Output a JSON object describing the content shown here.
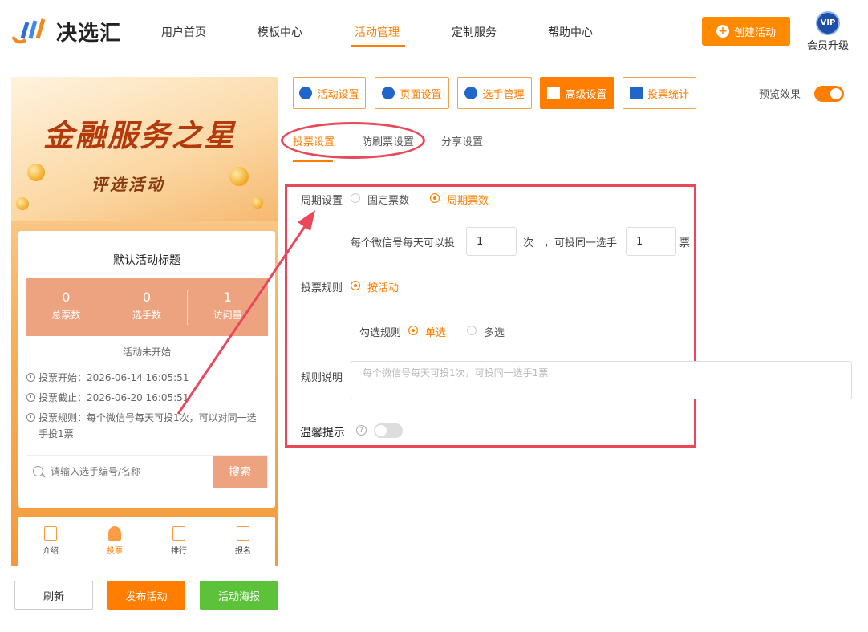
{
  "brand": {
    "name": "决选汇"
  },
  "nav": {
    "items": [
      "用户首页",
      "模板中心",
      "活动管理",
      "定制服务",
      "帮助中心"
    ],
    "active": "活动管理",
    "create_label": "创建活动",
    "vip_badge": "VIP",
    "vip_label": "会员升级"
  },
  "preview": {
    "banner_title": "金融服务之星",
    "banner_subtitle": "评选活动",
    "activity_title": "默认活动标题",
    "stats": [
      {
        "value": "0",
        "label": "总票数"
      },
      {
        "value": "0",
        "label": "选手数"
      },
      {
        "value": "1",
        "label": "访问量"
      }
    ],
    "status": "活动未开始",
    "vote_start": "投票开始：2026-06-14 16:05:51",
    "vote_end": "投票截止：2026-06-20 16:05:51",
    "vote_rule": "投票规则：每个微信号每天可投1次，可以对同一选手投1票",
    "search_placeholder": "请输入选手编号/名称",
    "search_button": "搜索",
    "bottom_tabs": [
      "介绍",
      "投票",
      "排行",
      "报名"
    ],
    "active_tab": "投票"
  },
  "actions": {
    "refresh": "刷新",
    "publish": "发布活动",
    "poster": "活动海报"
  },
  "settings_tabs": [
    "活动设置",
    "页面设置",
    "选手管理",
    "高级设置",
    "投票统计"
  ],
  "settings_active": "高级设置",
  "preview_effect": {
    "label": "预览效果",
    "on": true
  },
  "sub_tabs": [
    "投票设置",
    "防刷票设置",
    "分享设置"
  ],
  "sub_active": "投票设置",
  "form": {
    "period_label": "周期设置",
    "period_options": [
      "固定票数",
      "周期票数"
    ],
    "period_selected": "周期票数",
    "per_day_prefix": "每个微信号每天可以投",
    "times_value": "1",
    "times_unit": "次",
    "same_player_text": "，可投同一选手",
    "votes_value": "1",
    "votes_unit": "票",
    "rule_label": "投票规则",
    "rule_option": "按活动",
    "check_label": "勾选规则",
    "check_options": [
      "单选",
      "多选"
    ],
    "check_selected": "单选",
    "desc_label": "规则说明",
    "desc_placeholder": "每个微信号每天可投1次，可投同一选手1票",
    "tip_label": "温馨提示",
    "tip_on": false
  },
  "colors": {
    "accent": "#ff7d00",
    "highlight": "#e9475a",
    "green": "#5cc23a",
    "stat_bg": "#eda37f"
  }
}
